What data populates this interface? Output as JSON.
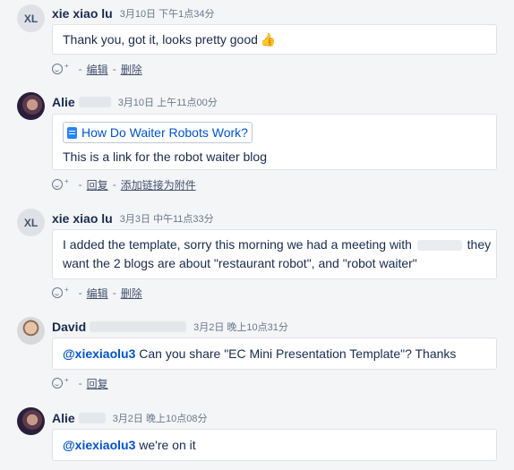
{
  "comments": [
    {
      "avatar_initials": "XL",
      "author": "xie xiao lu",
      "time": "3月10日 下午1点34分",
      "lines": [
        "Thank you, got it, looks pretty good"
      ],
      "emoji": "👍",
      "actions": [
        "编辑",
        "删除"
      ]
    },
    {
      "author": "Alie",
      "time": "3月10日 上午11点00分",
      "link_title": "How Do Waiter Robots Work?",
      "lines": [
        "This is a link for the robot waiter blog"
      ],
      "actions": [
        "回复",
        "添加链接为附件"
      ]
    },
    {
      "avatar_initials": "XL",
      "author": "xie xiao lu",
      "time": "3月3日 中午11点33分",
      "line1_a": "I added the template, sorry this morning we had a meeting with",
      "line1_b": "they",
      "line2": "want the 2 blogs are about \"restaurant robot\", and \"robot waiter\"",
      "actions": [
        "编辑",
        "删除"
      ]
    },
    {
      "author": "David",
      "time": "3月2日 晚上10点31分",
      "mention": "@xiexiaolu3",
      "text": "Can you share \"EC Mini Presentation Template\"? Thanks",
      "actions": [
        "回复"
      ]
    },
    {
      "author": "Alie",
      "time": "3月2日 晚上10点08分",
      "mention": "@xiexiaolu3",
      "text": "we're on it",
      "actions": []
    }
  ],
  "action_separator": "-",
  "icons": {
    "reaction": "add-reaction-icon",
    "document": "page-icon",
    "thumbs_up": "thumbs-up-icon"
  },
  "colors": {
    "mention": "#0052cc",
    "link": "#0052cc",
    "text": "#172b4d",
    "meta": "#6b778c",
    "background": "#f4f5f7"
  }
}
